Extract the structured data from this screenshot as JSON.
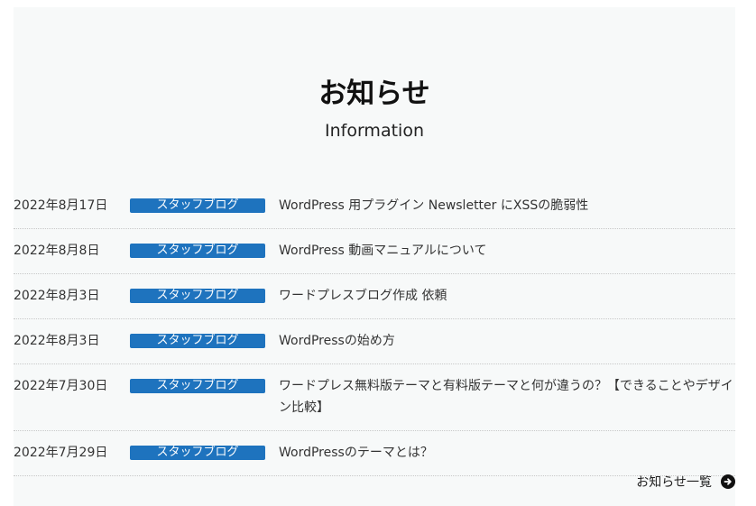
{
  "header": {
    "title": "お知らせ",
    "subtitle": "Information"
  },
  "colors": {
    "badge_bg": "#1e73be",
    "panel_bg": "#f7f9f9"
  },
  "news": [
    {
      "date": "2022年8月17日",
      "category": "スタッフブログ",
      "title": "WordPress 用プラグイン Newsletter にXSSの脆弱性"
    },
    {
      "date": "2022年8月8日",
      "category": "スタッフブログ",
      "title": "WordPress 動画マニュアルについて"
    },
    {
      "date": "2022年8月3日",
      "category": "スタッフブログ",
      "title": "ワードプレスブログ作成 依頼"
    },
    {
      "date": "2022年8月3日",
      "category": "スタッフブログ",
      "title": "WordPressの始め方"
    },
    {
      "date": "2022年7月30日",
      "category": "スタッフブログ",
      "title": "ワードプレス無料版テーマと有料版テーマと何が違うの？【できることやデザイン比較】"
    },
    {
      "date": "2022年7月29日",
      "category": "スタッフブログ",
      "title": "WordPressのテーマとは？"
    }
  ],
  "more_link": {
    "label": "お知らせ一覧",
    "icon": "arrow-circle-right-icon"
  }
}
